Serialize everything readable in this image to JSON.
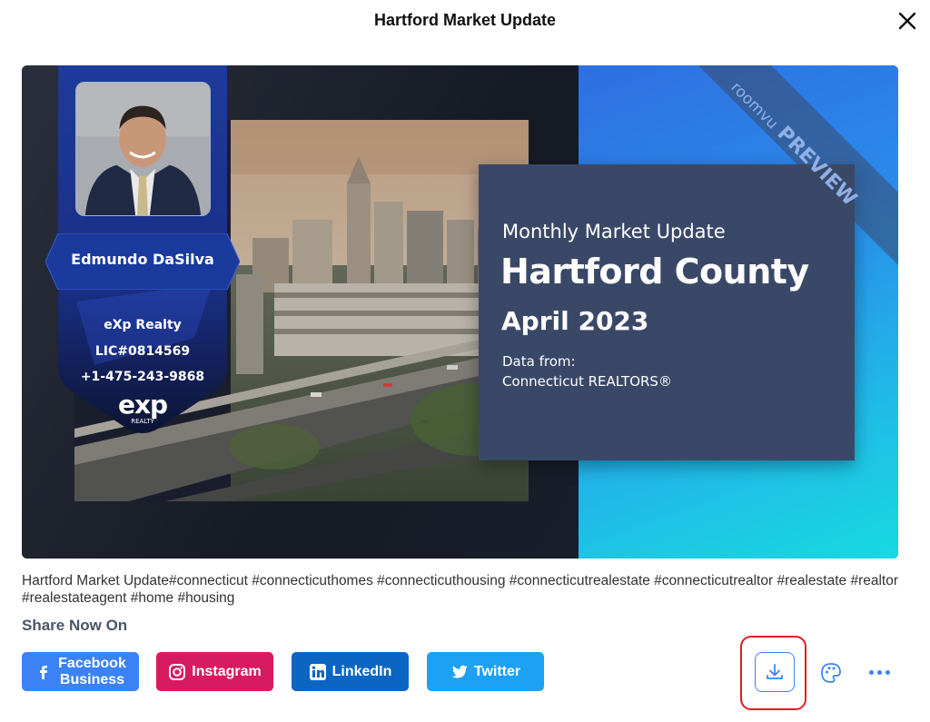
{
  "modal": {
    "title": "Hartford Market Update",
    "close_icon": "close-icon"
  },
  "preview": {
    "agent": {
      "name": "Edmundo DaSilva",
      "company": "eXp Realty",
      "license": "LIC#0814569",
      "phone": "+1-475-243-9868",
      "logo_text": "exp",
      "logo_subtext": "REALTY"
    },
    "card": {
      "subtitle": "Monthly Market Update",
      "title": "Hartford County",
      "date": "April 2023",
      "source_label": "Data from:",
      "source": "Connecticut REALTORS®"
    },
    "watermark": {
      "brand": "roomvu",
      "label": "PREVIEW"
    },
    "colors": {
      "card_bg": "#3a4868",
      "gradient_start": "#2f6fe0",
      "gradient_end": "#17d9e0",
      "ribbon": "#1f3a8a"
    }
  },
  "caption": "Hartford Market Update#connecticut #connecticuthomes #connecticuthousing #connecticutrealestate #connecticutrealtor #realestate #realtor #realestateagent #home #housing",
  "share": {
    "label": "Share Now On",
    "buttons": [
      {
        "label": "Facebook Business",
        "line1": "Facebook",
        "line2": "Business",
        "icon": "facebook-icon",
        "color": "#3b82f6"
      },
      {
        "label": "Instagram",
        "icon": "instagram-icon",
        "color": "#d81b60"
      },
      {
        "label": "LinkedIn",
        "icon": "linkedin-icon",
        "color": "#0a66c2"
      },
      {
        "label": "Twitter",
        "icon": "twitter-icon",
        "color": "#1da1f2"
      }
    ]
  },
  "actions": {
    "download_icon": "download-icon",
    "palette_icon": "palette-icon",
    "more_icon": "more-horizontal-icon",
    "accent": "#3b82f6",
    "highlight": "#e01b24"
  }
}
